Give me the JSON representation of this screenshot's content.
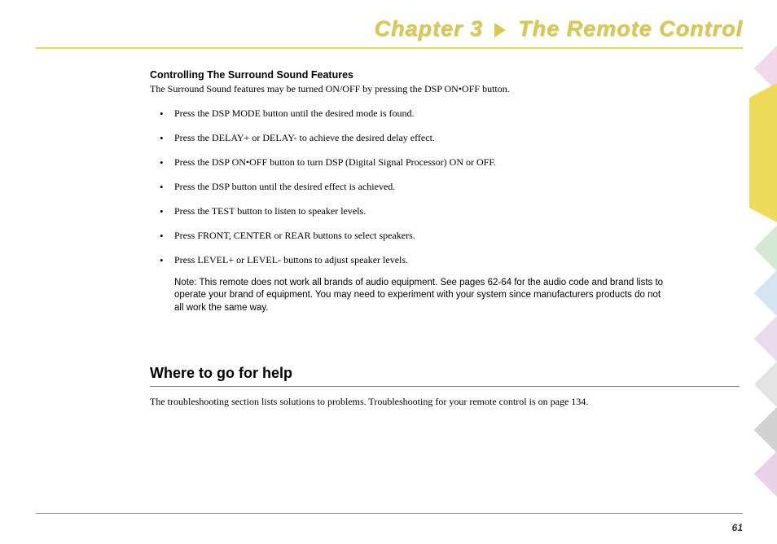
{
  "chapter": {
    "prefix": "Chapter 3",
    "title": "The Remote Control"
  },
  "section": {
    "heading": "Controlling The Surround Sound Features",
    "intro": "The Surround Sound features may be turned ON/OFF by pressing the DSP ON•OFF button.",
    "bullets": [
      "Press the DSP MODE button until the desired mode is found.",
      "Press the DELAY+ or DELAY- to achieve the desired delay effect.",
      "Press the DSP ON•OFF button to turn DSP (Digital Signal Processor) ON or OFF.",
      "Press the DSP button until the desired effect is achieved.",
      "Press the TEST button to listen to speaker levels.",
      "Press FRONT, CENTER or REAR buttons to select speakers.",
      "Press LEVEL+ or LEVEL- buttons to adjust speaker levels."
    ],
    "note": "Note: This remote does not work all brands of audio equipment. See pages 62-64 for the audio code and brand lists to operate your brand of equipment. You may need to experiment with your system since manufacturers products do not all work the same way."
  },
  "subsection": {
    "heading": "Where to go for help",
    "body": "The troubleshooting section lists solutions to problems. Troubleshooting for your remote control is on page 134."
  },
  "pageNumber": "61"
}
